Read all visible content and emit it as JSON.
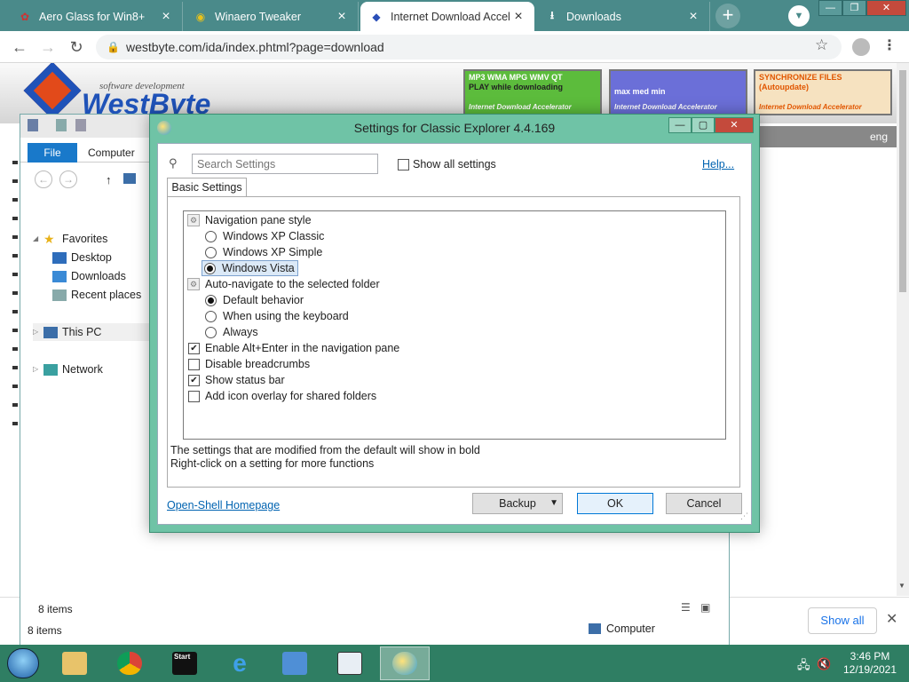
{
  "browser": {
    "tabs": [
      {
        "title": "Aero Glass for Win8+",
        "favicon": "aero-glass-favicon"
      },
      {
        "title": "Winaero Tweaker",
        "favicon": "winaero-favicon"
      },
      {
        "title": "Internet Download Accel",
        "favicon": "westbyte-favicon",
        "active": true
      },
      {
        "title": "Downloads",
        "favicon": "download-icon"
      }
    ],
    "url": "westbyte.com/ida/index.phtml?page=download"
  },
  "site": {
    "logo_sub": "software development",
    "logo_text": "WestByte",
    "banners": [
      {
        "line1": "MP3 WMA MPG WMV QT",
        "line2": "PLAY while downloading",
        "footer": "Internet Download Accelerator"
      },
      {
        "line1": "max   med   min",
        "line2": "",
        "footer": "Internet Download Accelerator"
      },
      {
        "line1": "SYNCHRONIZE FILES",
        "line2": "(Autoupdate)",
        "footer": "Internet Download Accelerator"
      }
    ],
    "lang": "eng"
  },
  "downloads_bar": {
    "show_all": "Show all"
  },
  "explorer": {
    "ribbon_tabs": [
      "File",
      "Computer"
    ],
    "favorites": "Favorites",
    "fav_items": [
      "Desktop",
      "Downloads",
      "Recent places"
    ],
    "this_pc": "This PC",
    "network": "Network",
    "items_count": "8 items",
    "items_count2": "8 items",
    "status_location": "Computer"
  },
  "dialog": {
    "title": "Settings for Classic Explorer 4.4.169",
    "search_placeholder": "Search Settings",
    "show_all_settings": "Show all settings",
    "help": "Help...",
    "tab": "Basic Settings",
    "settings": {
      "nav_pane_style": "Navigation pane style",
      "nav_options": [
        "Windows XP Classic",
        "Windows XP Simple",
        "Windows Vista"
      ],
      "nav_selected": "Windows Vista",
      "auto_navigate": "Auto-navigate to the selected folder",
      "auto_options": [
        "Default behavior",
        "When using the keyboard",
        "Always"
      ],
      "auto_selected": "Default behavior",
      "checkboxes": [
        {
          "label": "Enable Alt+Enter in the navigation pane",
          "checked": true
        },
        {
          "label": "Disable breadcrumbs",
          "checked": false
        },
        {
          "label": "Show status bar",
          "checked": true
        },
        {
          "label": "Add icon overlay for shared folders",
          "checked": false
        }
      ]
    },
    "info_line1": "The settings that are modified from the default will show in bold",
    "info_line2": "Right-click on a setting for more functions",
    "homepage_link": "Open-Shell Homepage",
    "buttons": {
      "backup": "Backup",
      "ok": "OK",
      "cancel": "Cancel"
    }
  },
  "taskbar": {
    "start_label": "Start",
    "time": "3:46 PM",
    "date": "12/19/2021"
  },
  "colors": {
    "accent": "#6fc3a6",
    "taskbar": "#2f7e63",
    "browser_frame": "#4a8a8a",
    "link": "#0063b1"
  }
}
